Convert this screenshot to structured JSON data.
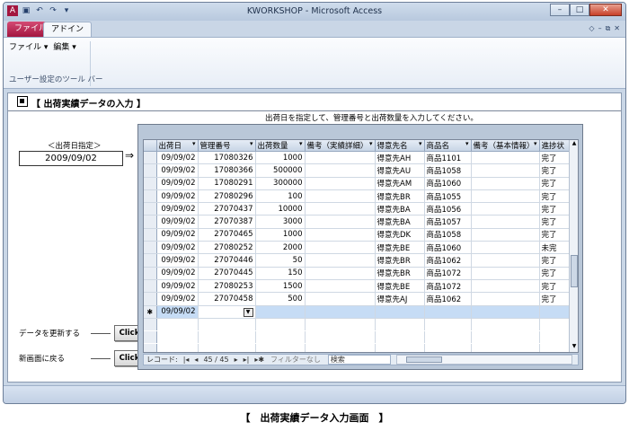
{
  "window": {
    "title": "KWORKSHOP - Microsoft Access",
    "controls": {
      "minimize": "–",
      "maximize": "□",
      "close": "✕"
    },
    "qat_icons": [
      "access-logo-icon",
      "save-icon",
      "undo-icon",
      "redo-icon",
      "customize-icon"
    ]
  },
  "ribbon": {
    "tabs": [
      {
        "label": "ファイル"
      },
      {
        "label": "アドイン"
      }
    ],
    "menu_items": [
      {
        "label": "ファイル ▾"
      },
      {
        "label": "編集 ▾"
      }
    ],
    "group_label": "ユーザー設定のツール バー",
    "right_icons": [
      "◇",
      "–",
      "⧉",
      "✕"
    ]
  },
  "form": {
    "title": "【 出荷実績データの入力 】",
    "instruction": "出荷日を指定して、管理番号と出荷数量を入力してください。",
    "date_label": "＜出荷日指定＞",
    "date_value": "2009/09/02",
    "date_arrow": "⇒",
    "actions": [
      {
        "label": "データを更新する",
        "button": "Click"
      },
      {
        "label": "新画面に戻る",
        "button": "Click"
      }
    ]
  },
  "grid": {
    "columns": [
      "出荷日",
      "管理番号",
      "出荷数量",
      "備考（実績詳細）",
      "得意先名",
      "商品名",
      "備考（基本情報）",
      "進捗状"
    ],
    "sort_glyph": "▾",
    "rows": [
      [
        "09/09/02",
        "17080326",
        "1000",
        "",
        "得意先AH",
        "商品1101",
        "",
        "完了"
      ],
      [
        "09/09/02",
        "17080366",
        "500000",
        "",
        "得意先AU",
        "商品1058",
        "",
        "完了"
      ],
      [
        "09/09/02",
        "17080291",
        "300000",
        "",
        "得意先AM",
        "商品1060",
        "",
        "完了"
      ],
      [
        "09/09/02",
        "27080296",
        "100",
        "",
        "得意先BR",
        "商品1055",
        "",
        "完了"
      ],
      [
        "09/09/02",
        "27070437",
        "10000",
        "",
        "得意先BA",
        "商品1056",
        "",
        "完了"
      ],
      [
        "09/09/02",
        "27070387",
        "3000",
        "",
        "得意先BA",
        "商品1057",
        "",
        "完了"
      ],
      [
        "09/09/02",
        "27070465",
        "1000",
        "",
        "得意先DK",
        "商品1058",
        "",
        "完了"
      ],
      [
        "09/09/02",
        "27080252",
        "2000",
        "",
        "得意先BE",
        "商品1060",
        "",
        "未完"
      ],
      [
        "09/09/02",
        "27070446",
        "50",
        "",
        "得意先BR",
        "商品1062",
        "",
        "完了"
      ],
      [
        "09/09/02",
        "27070445",
        "150",
        "",
        "得意先BR",
        "商品1072",
        "",
        "完了"
      ],
      [
        "09/09/02",
        "27080253",
        "1500",
        "",
        "得意先BE",
        "商品1072",
        "",
        "完了"
      ],
      [
        "09/09/02",
        "27070458",
        "500",
        "",
        "得意先AJ",
        "商品1062",
        "",
        "完了"
      ]
    ],
    "new_row": {
      "marker": "✱",
      "date": "09/09/02",
      "dropdown": "▼"
    }
  },
  "navbar": {
    "record_label": "レコード:",
    "first": "|◂",
    "prev": "◂",
    "position": "45 / 45",
    "next": "▸",
    "last": "▸|",
    "new": "▸✱",
    "filter": "フィルターなし",
    "search": "検索"
  },
  "caption": "【　出荷実績データ入力画面　】"
}
